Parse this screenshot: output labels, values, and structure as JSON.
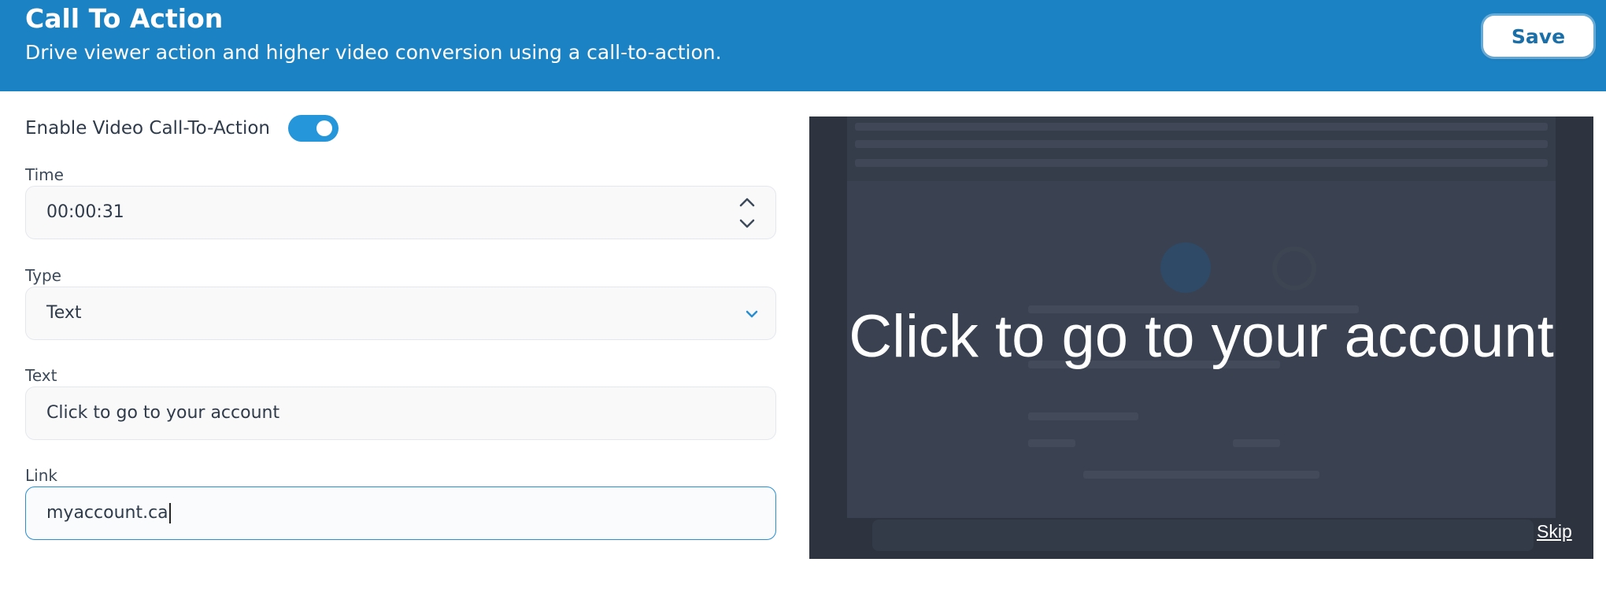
{
  "header": {
    "title": "Call To Action",
    "subtitle": "Drive viewer action and higher video conversion using a call-to-action.",
    "save_label": "Save",
    "background_color": "#1b82c4"
  },
  "form": {
    "enable_toggle": {
      "label": "Enable Video Call-To-Action",
      "enabled": true,
      "color": "#2596d9"
    },
    "time": {
      "label": "Time",
      "value": "00:00:31",
      "icon": "up-down-stepper-icon"
    },
    "type": {
      "label": "Type",
      "value": "Text",
      "icon": "chevron-down-icon"
    },
    "text": {
      "label": "Text",
      "value": "Click to go to your account"
    },
    "link": {
      "label": "Link",
      "value": "myaccount.ca",
      "focused": true
    }
  },
  "preview": {
    "cta_text": "Click to go to your account",
    "skip_label": "Skip"
  }
}
